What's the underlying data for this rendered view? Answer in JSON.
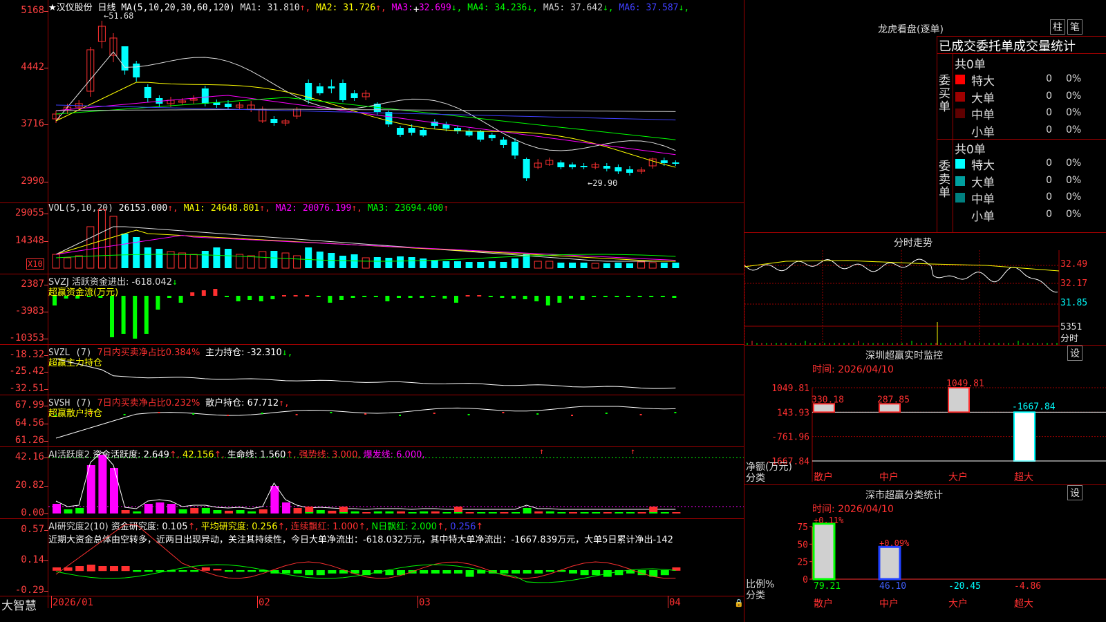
{
  "main": {
    "stock_name": "★汉仪股份",
    "period": "日线",
    "ma_header": "MA(5,10,20,30,60,120)",
    "ma": [
      {
        "label": "MA1:",
        "value": "31.810",
        "arrow": "↑",
        "color": "#e0e0e0"
      },
      {
        "label": "MA2:",
        "value": "31.726",
        "arrow": "↑",
        "color": "#ffff00"
      },
      {
        "label": "MA3:",
        "value": "32.699",
        "arrow": "↓",
        "color": "#ff00ff"
      },
      {
        "label": "MA4:",
        "value": "34.236",
        "arrow": "↓",
        "color": "#00ff00"
      },
      {
        "label": "MA5:",
        "value": "37.642",
        "arrow": "↓",
        "color": "#d0d0d0"
      },
      {
        "label": "MA6:",
        "value": "37.587",
        "arrow": "↓",
        "color": "#4040ff"
      }
    ],
    "y_labels": [
      "5168",
      "4442",
      "3716",
      "2990"
    ],
    "high_mark": "51.68",
    "low_mark": "←29.90"
  },
  "vol": {
    "header": "VOL(5,10,20)",
    "value": "26153.000",
    "ma1": "MA1: 24648.801",
    "ma2": "MA2: 20076.199",
    "ma3": "MA3: 23694.400",
    "y_labels": [
      "29055",
      "14348"
    ],
    "unit": "X10"
  },
  "svzj": {
    "header": "SVZJ  活跃资金进出: -618.042",
    "arrow": "↓",
    "subtitle": "超赢资金流(万元)",
    "y_labels": [
      "2387",
      "-3983",
      "-10353"
    ]
  },
  "svzl": {
    "name": "SVZL (7)",
    "ratio": "7日内买卖净占比0.384%",
    "hold": "主力持仓: -32.310",
    "arrow": "↓,",
    "subtitle": "超赢主力持仓",
    "y_labels": [
      "-18.32",
      "-25.42",
      "-32.51"
    ]
  },
  "svsh": {
    "name": "SVSH (7)",
    "ratio": "7日内买卖净占比0.232%",
    "hold": "散户持仓: 67.712",
    "arrow": "↑,",
    "subtitle": "超赢散户持仓",
    "y_labels": [
      "67.99",
      "64.56",
      "61.26"
    ]
  },
  "ai1": {
    "name": "AI活跃度2",
    "activity": "资金活跃度: 2.649",
    "v2": "42.156",
    "life": "生命线: 1.560",
    "strong": "强势线: 3.000",
    "burst": "爆发线: 6.000",
    "y_labels": [
      "42.16",
      "20.82",
      "0.00"
    ]
  },
  "ai2": {
    "name": "AI研究度2(10)",
    "research": "资金研究度: 0.105",
    "avg": "平均研究度: 0.256",
    "cont": "连续飘红: 1.000",
    "n": "N日飘红: 2.000",
    "v5": "0.256",
    "comment": "近期大资金总体由空转多，近两日出现异动，关注其持续性，今日大单净流出：-618.032万元，其中特大单净流出：-1667.839万元，大单5日累计净出-142",
    "y_labels": [
      "0.57",
      "0.14",
      "-0.29"
    ]
  },
  "xaxis": {
    "labels": [
      "2026/01",
      "02",
      "03",
      "04"
    ]
  },
  "brand": "大智慧",
  "right": {
    "lhb_title": "龙虎看盘(逐单)",
    "btn_zhu": "柱",
    "btn_bi": "笔",
    "tabs": "已成交委托单成交量统计",
    "buy_label": "委买单",
    "sell_label": "委卖单",
    "buy_total": "共0单",
    "sell_total": "共0单",
    "buy_rows": [
      {
        "label": "特大",
        "count": "0",
        "pct": "0%",
        "color": "#ff0000"
      },
      {
        "label": "大单",
        "count": "0",
        "pct": "0%",
        "color": "#a00000"
      },
      {
        "label": "中单",
        "count": "0",
        "pct": "0%",
        "color": "#600000"
      },
      {
        "label": "小单",
        "count": "0",
        "pct": "0%",
        "color": ""
      }
    ],
    "sell_rows": [
      {
        "label": "特大",
        "count": "0",
        "pct": "0%",
        "color": "#00ffff"
      },
      {
        "label": "大单",
        "count": "0",
        "pct": "0%",
        "color": "#00a0a0"
      },
      {
        "label": "中单",
        "count": "0",
        "pct": "0%",
        "color": "#008080"
      },
      {
        "label": "小单",
        "count": "0",
        "pct": "0%",
        "color": ""
      }
    ],
    "fs_title": "分时走势",
    "fs_y": [
      "32.49",
      "32.17",
      "31.85"
    ],
    "fs_vol": "5351",
    "fs_unit": "分时",
    "sz_title": "深圳超赢实时监控",
    "sz_set": "设",
    "sz_time": "时间: 2026/04/10",
    "sz_y": [
      "1049.81",
      "143.93",
      "-761.96",
      "-1667.84"
    ],
    "sz_unit1": "净额(万元)",
    "sz_unit2": "分类",
    "sz_cats": [
      "散户",
      "中户",
      "大户",
      "超大"
    ],
    "sz_values": [
      "330.18",
      "287.85",
      "1049.81",
      "-1667.84"
    ],
    "ss_title": "深市超赢分类统计",
    "ss_set": "设",
    "ss_time": "时间: 2026/04/10",
    "ss_y": [
      "75",
      "50",
      "25",
      "0"
    ],
    "ss_unit1": "比例%",
    "ss_unit2": "分类",
    "ss_cats": [
      "散户",
      "中户",
      "大户",
      "超大"
    ],
    "ss_top": [
      "+0.11%",
      "+0.09%"
    ],
    "ss_values": [
      "79.21",
      "46.10",
      "-20.45",
      "-4.86"
    ]
  },
  "chart_data": [
    {
      "type": "bar",
      "title": "深圳超赢实时监控",
      "categories": [
        "散户",
        "中户",
        "大户",
        "超大"
      ],
      "values": [
        330.18,
        287.85,
        1049.81,
        -1667.84
      ],
      "ylabel": "净额(万元)",
      "ylim": [
        -1667.84,
        1049.81
      ]
    },
    {
      "type": "bar",
      "title": "深市超赢分类统计",
      "categories": [
        "散户",
        "中户",
        "大户",
        "超大"
      ],
      "values": [
        79.21,
        46.1,
        -20.45,
        -4.86
      ],
      "ylabel": "比例%",
      "ylim": [
        0,
        75
      ]
    }
  ]
}
